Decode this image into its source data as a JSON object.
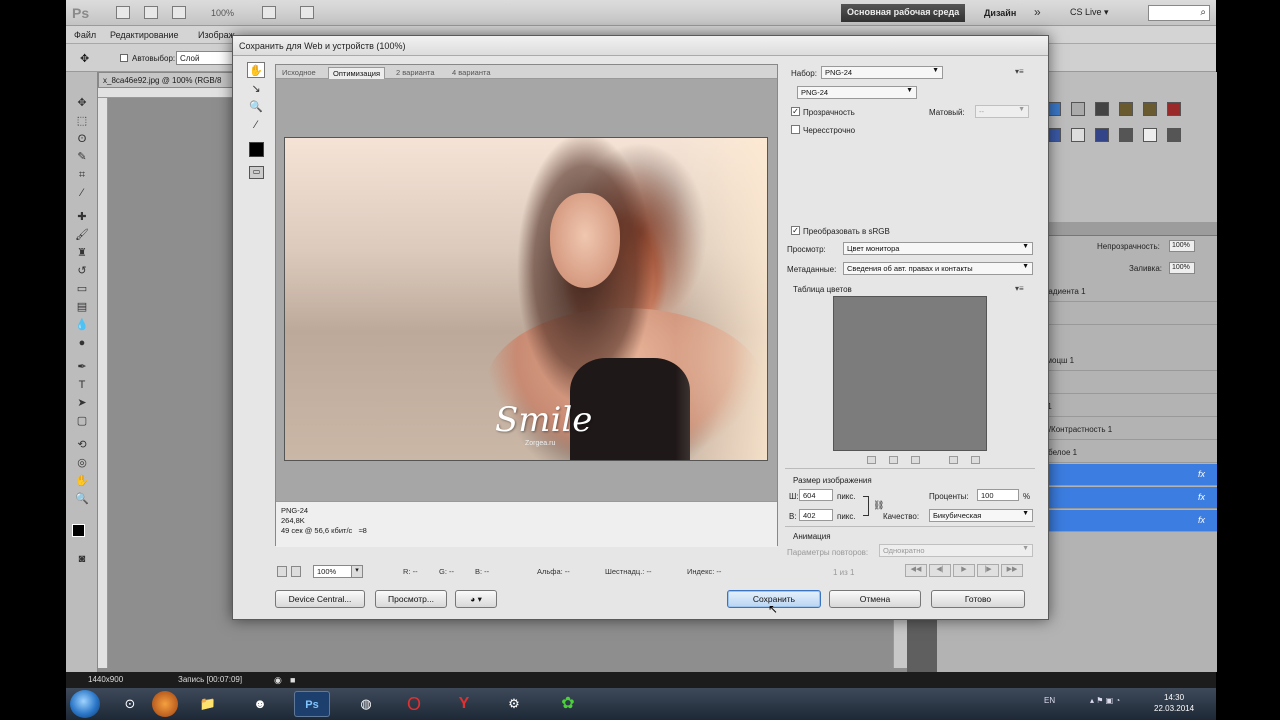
{
  "appbar": {
    "logo": "Ps",
    "zoom": "100%",
    "workspace": "Основная рабочая среда",
    "design": "Дизайн",
    "more": "»",
    "cslive": "CS Live ▾"
  },
  "menubar": {
    "items": [
      "Файл",
      "Редактирование",
      "Изображ"
    ]
  },
  "optbar": {
    "autoselect_label": "Автовыбор:",
    "autoselect_value": "Слой"
  },
  "document_tab": "x_8ca46e92.jpg @ 100% (RGB/8",
  "dialog": {
    "title": "Сохранить для Web и устройств (100%)",
    "tabs": [
      "Исходное",
      "Оптимизация",
      "2 варианта",
      "4 варианта"
    ],
    "photo": {
      "watermark": "Smile",
      "site": "Zorgea.ru"
    },
    "info": [
      "PNG-24",
      "264,8K",
      "49 сек @ 56,6 кбит/с",
      "≈8"
    ],
    "zoombar": {
      "zoom": "100%",
      "r": "R: --",
      "g": "G: --",
      "b": "B: --",
      "alpha": "Альфа: --",
      "hex": "Шестнадц.: --",
      "index": "Индекс: --"
    },
    "buttons": {
      "device_central": "Device Central...",
      "preview": "Просмотр...",
      "save": "Сохранить",
      "cancel": "Отмена",
      "done": "Готово"
    },
    "settings": {
      "preset_label": "Набор:",
      "preset_value": "PNG-24",
      "format_value": "PNG-24",
      "transparency": "Прозрачность",
      "interlaced": "Чересстрочно",
      "matte_label": "Матовый:",
      "matte_value": "--",
      "convert_srgb": "Преобразовать в sRGB",
      "preview_label": "Просмотр:",
      "preview_value": "Цвет монитора",
      "metadata_label": "Метаданные:",
      "metadata_value": "Сведения об авт. правах и контакты",
      "color_table": "Таблица цветов",
      "image_size": "Размер изображения",
      "w_label": "Ш:",
      "w_value": "604",
      "h_label": "В:",
      "h_value": "402",
      "px": "пикс.",
      "percent_label": "Проценты:",
      "percent_value": "100",
      "percent_unit": "%",
      "quality_label": "Качество:",
      "quality_value": "Бикубическая",
      "animation": "Анимация",
      "loop_label": "Параметры повторов:",
      "loop_value": "Однократно",
      "frame_counter": "1 из 1"
    }
  },
  "rpanel": {
    "opacity_label": "Непрозрачность:",
    "opacity_value": "100%",
    "fill_label": "Заливка:",
    "fill_value": "100%",
    "layers": [
      "градиента 1",
      "",
      "ммоцш 1",
      "",
      "ь 1",
      "ть/Контрастность 1",
      "о-белое 1",
      "",
      "",
      ""
    ],
    "fx": "fx"
  },
  "statusbar": {
    "resolution": "1440x900",
    "record": "Запись [00:07:09]"
  },
  "taskbar": {
    "lang": "EN",
    "time": "14:30",
    "date": "22.03.2014"
  },
  "colors": {
    "selection": "#3b7de0",
    "dialog_bg": "#e6e6e6",
    "workspace": "#8e8e8e"
  }
}
